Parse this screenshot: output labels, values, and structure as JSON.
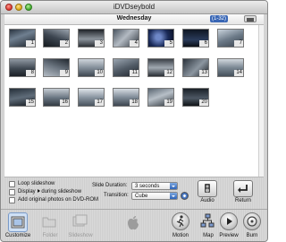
{
  "window": {
    "title": "iDVDseybold"
  },
  "header": {
    "title": "Wednesday",
    "pages": "(1-32)"
  },
  "thumbnails": [
    {
      "n": "1"
    },
    {
      "n": "2"
    },
    {
      "n": "3"
    },
    {
      "n": "4"
    },
    {
      "n": "5"
    },
    {
      "n": "6"
    },
    {
      "n": "7"
    },
    {
      "n": "8"
    },
    {
      "n": "9"
    },
    {
      "n": "10"
    },
    {
      "n": "11"
    },
    {
      "n": "12"
    },
    {
      "n": "13"
    },
    {
      "n": "14"
    },
    {
      "n": "15"
    },
    {
      "n": "16"
    },
    {
      "n": "17"
    },
    {
      "n": "18"
    },
    {
      "n": "19"
    },
    {
      "n": "20"
    }
  ],
  "settings": {
    "loop_label": "Loop slideshow",
    "display_label_a": "Display",
    "display_label_b": "during slideshow",
    "add_original_label": "Add original photos on DVD-ROM",
    "duration_label": "Slide Duration:",
    "duration_value": "3 seconds",
    "transition_label": "Transition:",
    "transition_value": "Cube"
  },
  "buttons": {
    "audio": "Audio",
    "return": "Return"
  },
  "toolbar": {
    "customize": "Customize",
    "folder": "Folder",
    "slideshow": "Slideshow",
    "motion": "Motion",
    "map": "Map",
    "preview": "Preview",
    "burn": "Burn"
  },
  "colors": {
    "accent": "#2e64b8",
    "toolbar_selected": "#cfe0f5"
  }
}
